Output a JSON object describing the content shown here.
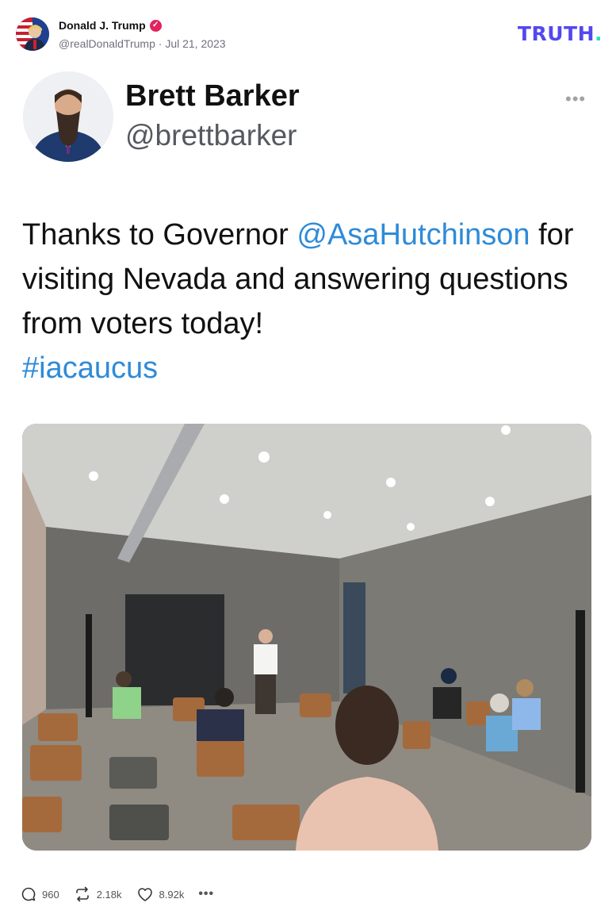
{
  "post": {
    "author_name": "Donald J. Trump",
    "author_handle": "@realDonaldTrump",
    "date": "Jul 21, 2023",
    "verified_icon": "verified-check-icon",
    "accent": "#5448ee"
  },
  "brand": {
    "logo_text": "TRUTH",
    "logo_dot": "."
  },
  "tweet": {
    "name": "Brett Barker",
    "handle": "@brettbarker",
    "more": "•••",
    "text_before": "Thanks to Governor ",
    "mention": "@AsaHutchinson",
    "text_after": " for visiting Nevada and answering questions from voters today!",
    "hashtag": "#iacaucus",
    "link_color": "#2e8bd8"
  },
  "actions": {
    "replies": "960",
    "retruths": "2.18k",
    "likes": "8.92k",
    "more": "•••"
  }
}
